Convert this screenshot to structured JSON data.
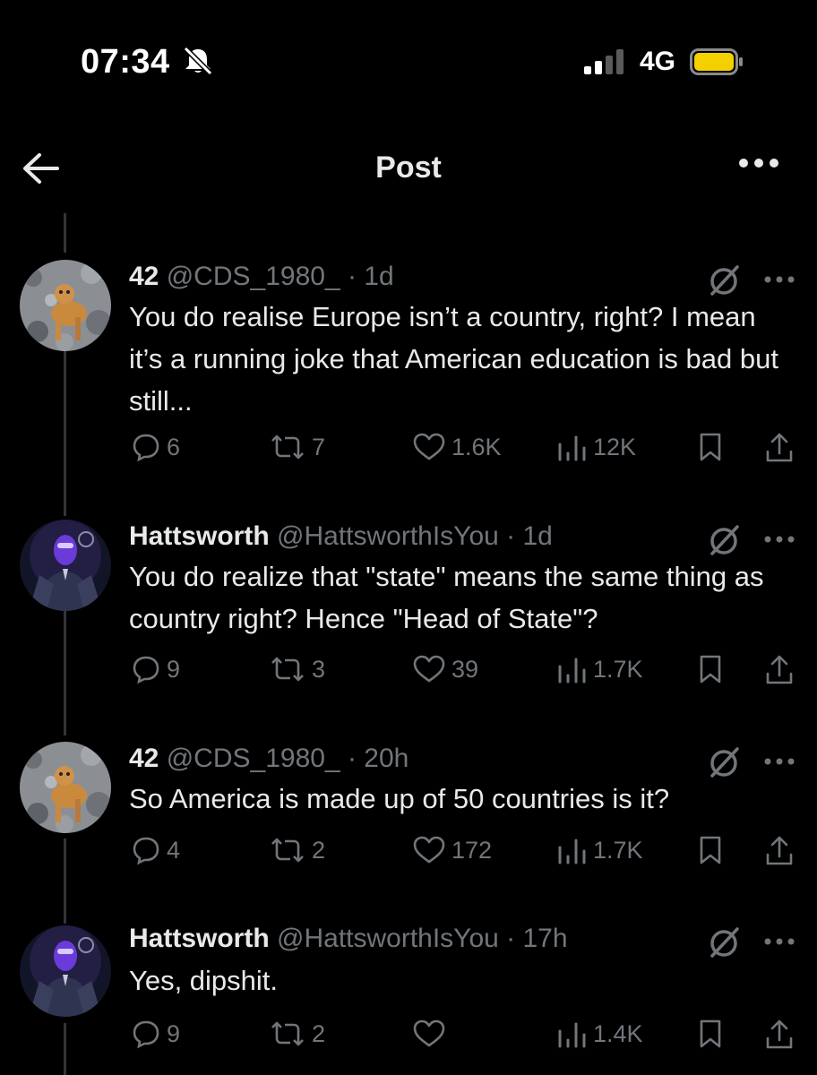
{
  "status_bar": {
    "time": "07:34",
    "network": "4G",
    "battery_color": "#f5d000"
  },
  "header": {
    "title": "Post"
  },
  "colors": {
    "background": "#000000",
    "text": "#e7e9ea",
    "muted": "#71767b",
    "divider": "#333639"
  },
  "replies": [
    {
      "name": "42",
      "handle": "@CDS_1980_",
      "time": "1d",
      "text": "You do realise Europe isn’t a country, right? I mean it’s a running joke that American education is bad but still...",
      "replies": "6",
      "reposts": "7",
      "likes": "1.6K",
      "views": "12K"
    },
    {
      "name": "Hattsworth",
      "handle": "@HattsworthIsYou",
      "time": "1d",
      "text": "You do realize that \"state\" means the same thing as country right? Hence \"Head of State\"?",
      "replies": "9",
      "reposts": "3",
      "likes": "39",
      "views": "1.7K"
    },
    {
      "name": "42",
      "handle": "@CDS_1980_",
      "time": "20h",
      "text": "So America is made up of 50 countries is it?",
      "replies": "4",
      "reposts": "2",
      "likes": "172",
      "views": "1.7K"
    },
    {
      "name": "Hattsworth",
      "handle": "@HattsworthIsYou",
      "time": "17h",
      "text": "Yes, dipshit.",
      "replies": "9",
      "reposts": "2",
      "likes": "",
      "views": "1.4K"
    }
  ],
  "icons": [
    "bell-muted-icon",
    "signal-icon",
    "battery-icon",
    "back-arrow-icon",
    "more-icon",
    "grok-icon",
    "reply-icon",
    "repost-icon",
    "like-icon",
    "views-icon",
    "bookmark-icon",
    "share-icon"
  ]
}
